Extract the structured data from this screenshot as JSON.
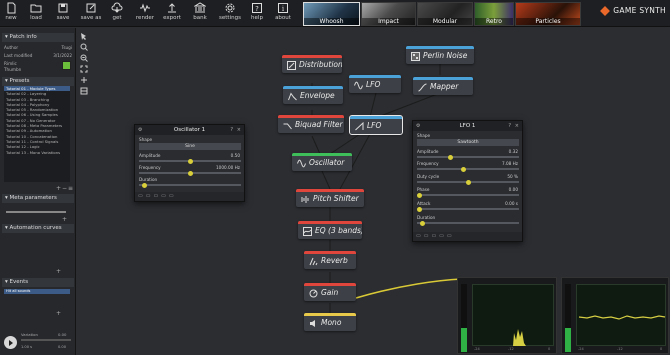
{
  "toolbar": {
    "buttons": [
      {
        "label": "new",
        "icon": "new-file-icon"
      },
      {
        "label": "load",
        "icon": "folder-icon"
      },
      {
        "label": "save",
        "icon": "save-icon"
      },
      {
        "label": "save as",
        "icon": "save-as-icon"
      },
      {
        "label": "get",
        "icon": "cloud-download-icon"
      },
      {
        "label": "render",
        "icon": "render-icon"
      },
      {
        "label": "export",
        "icon": "export-icon"
      },
      {
        "label": "bank",
        "icon": "bank-icon"
      },
      {
        "label": "settings",
        "icon": "gear-icon"
      },
      {
        "label": "help",
        "icon": "help-icon"
      },
      {
        "label": "about",
        "icon": "info-icon"
      }
    ],
    "category_tabs": [
      {
        "label": "Whoosh",
        "active": true
      },
      {
        "label": "Impact",
        "active": false
      },
      {
        "label": "Modular",
        "active": false
      },
      {
        "label": "Retro",
        "active": false
      },
      {
        "label": "Particles",
        "active": false
      }
    ],
    "logo_text": "GAME SYNTH"
  },
  "left_panel": {
    "patch_info": {
      "title": "Patch info",
      "rows": [
        {
          "label": "Author",
          "value": "Tsugi"
        },
        {
          "label": "Last modified",
          "value": "3/1/2022"
        },
        {
          "label": "Rimlic",
          "value": ""
        },
        {
          "label": "Thumbn",
          "value": ""
        }
      ]
    },
    "presets": {
      "title": "Presets",
      "items": [
        "Tutorial 01 - Module Types",
        "Tutorial 02 - Layering",
        "Tutorial 03 - Branching",
        "Tutorial 04 - Polyphony",
        "Tutorial 05 - Randomization",
        "Tutorial 06 - Using Samples",
        "Tutorial 07 - No Generator",
        "Tutorial 08 - Meta Parameters",
        "Tutorial 09 - Automation",
        "Tutorial 10 - Concatenation",
        "Tutorial 11 - Control Signals",
        "Tutorial 12 - Logic",
        "Tutorial 13 - Mono Variations"
      ],
      "selected_index": 0
    },
    "meta_parameters": {
      "title": "Meta parameters"
    },
    "automation_curves": {
      "title": "Automation curves"
    },
    "events": {
      "title": "Events",
      "items": [
        "Hit all sounds"
      ]
    },
    "transport": {
      "variation_label": "Variation",
      "variation_value": "0.00",
      "time_label": "1.00 s",
      "value_label": "0.00"
    }
  },
  "graph": {
    "nodes": [
      {
        "id": "distribution",
        "label": "Distribution",
        "bar_color": "#e0463c",
        "icon": "distribution-icon"
      },
      {
        "id": "envelope",
        "label": "Envelope",
        "bar_color": "#4aa2d9",
        "icon": "envelope-icon"
      },
      {
        "id": "biquad",
        "label": "Biquad Filter",
        "bar_color": "#e0463c",
        "icon": "filter-icon"
      },
      {
        "id": "oscillator",
        "label": "Oscillator",
        "bar_color": "#3fbf59",
        "icon": "sine-wave-icon"
      },
      {
        "id": "lfo_a",
        "label": "LFO",
        "bar_color": "#4aa2d9",
        "icon": "sine-wave-icon"
      },
      {
        "id": "lfo_b",
        "label": "LFO",
        "bar_color": "#4aa2d9",
        "icon": "sawtooth-wave-icon"
      },
      {
        "id": "perlin",
        "label": "Perlin Noise",
        "bar_color": "#4aa2d9",
        "icon": "noise-icon"
      },
      {
        "id": "mapper",
        "label": "Mapper",
        "bar_color": "#4aa2d9",
        "icon": "mapper-icon"
      },
      {
        "id": "pitchshifter",
        "label": "Pitch Shifter",
        "bar_color": "#e0463c",
        "icon": "pitch-icon"
      },
      {
        "id": "eq",
        "label": "EQ (3 bands)",
        "bar_color": "#e0463c",
        "icon": "eq-icon"
      },
      {
        "id": "reverb",
        "label": "Reverb",
        "bar_color": "#e0463c",
        "icon": "reverb-icon"
      },
      {
        "id": "gain",
        "label": "Gain",
        "bar_color": "#e0463c",
        "icon": "gain-icon"
      },
      {
        "id": "mono",
        "label": "Mono",
        "bar_color": "#e8c94a",
        "icon": "speaker-icon"
      }
    ]
  },
  "oscillator_panel": {
    "title": "Oscillator 1",
    "shape_label": "Shape",
    "shape_value": "Sine",
    "amplitude_label": "Amplitude",
    "amplitude_value": "0.50",
    "amplitude_level": 0.5,
    "frequency_label": "Frequency",
    "frequency_value": "1000.00 Hz",
    "frequency_level": 0.5,
    "duration_label": "Duration",
    "duration_value": "",
    "duration_level": 0.03,
    "help_icon": "help-icon",
    "close_icon": "close-icon"
  },
  "lfo_panel": {
    "title": "LFO 1",
    "shape_label": "Shape",
    "shape_value": "Sawtooth",
    "amplitude_label": "Amplitude",
    "amplitude_value": "0.32",
    "amplitude_level": 0.32,
    "frequency_label": "Frequency",
    "frequency_value": "7.08 Hz",
    "frequency_level": 0.45,
    "dutycycle_label": "Duty cycle",
    "dutycycle_value": "50 %",
    "dutycycle_level": 0.5,
    "phase_label": "Phase",
    "phase_value": "0.00",
    "phase_level": 0.0,
    "attack_label": "Attack",
    "attack_value": "0.00 s",
    "attack_level": 0.0,
    "duration_label": "Duration",
    "duration_value": "",
    "duration_level": 0.03
  },
  "scopes": {
    "left_tick_labels": [
      "-24",
      "-12",
      "0"
    ],
    "right_tick_labels": [
      "-24",
      "-12",
      "0"
    ]
  }
}
